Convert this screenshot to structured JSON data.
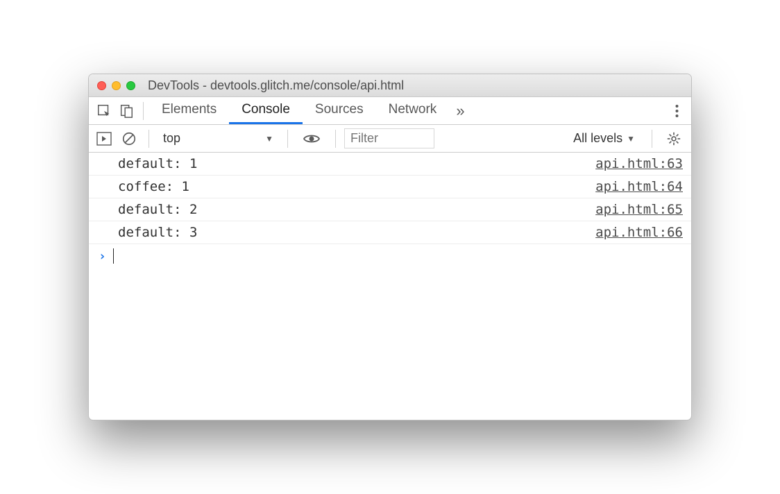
{
  "window": {
    "title": "DevTools - devtools.glitch.me/console/api.html"
  },
  "tabs": {
    "items": [
      "Elements",
      "Console",
      "Sources",
      "Network"
    ],
    "active_index": 1
  },
  "filterbar": {
    "context": "top",
    "filter_placeholder": "Filter",
    "levels_label": "All levels"
  },
  "console": {
    "rows": [
      {
        "message": "default: 1",
        "source": "api.html:63"
      },
      {
        "message": "coffee: 1",
        "source": "api.html:64"
      },
      {
        "message": "default: 2",
        "source": "api.html:65"
      },
      {
        "message": "default: 3",
        "source": "api.html:66"
      }
    ]
  }
}
